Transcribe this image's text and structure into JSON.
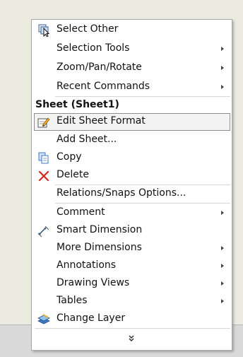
{
  "menu": {
    "items": [
      {
        "label": "Select Other"
      },
      {
        "label": "Selection Tools"
      },
      {
        "label": "Zoom/Pan/Rotate"
      },
      {
        "label": "Recent Commands"
      },
      {
        "label": "Edit Sheet Format"
      },
      {
        "label": "Add Sheet..."
      },
      {
        "label": "Copy"
      },
      {
        "label": "Delete"
      },
      {
        "label": "Relations/Snaps Options..."
      },
      {
        "label": "Comment"
      },
      {
        "label": "Smart Dimension"
      },
      {
        "label": "More Dimensions"
      },
      {
        "label": "Annotations"
      },
      {
        "label": "Drawing Views"
      },
      {
        "label": "Tables"
      },
      {
        "label": "Change Layer"
      }
    ],
    "section_heading": "Sheet (Sheet1)"
  },
  "colors": {
    "delete_icon": "#d4281c",
    "copy_icon": "#3d78c8",
    "menu_background": "#ffffff",
    "page_background": "#ebeadf"
  }
}
